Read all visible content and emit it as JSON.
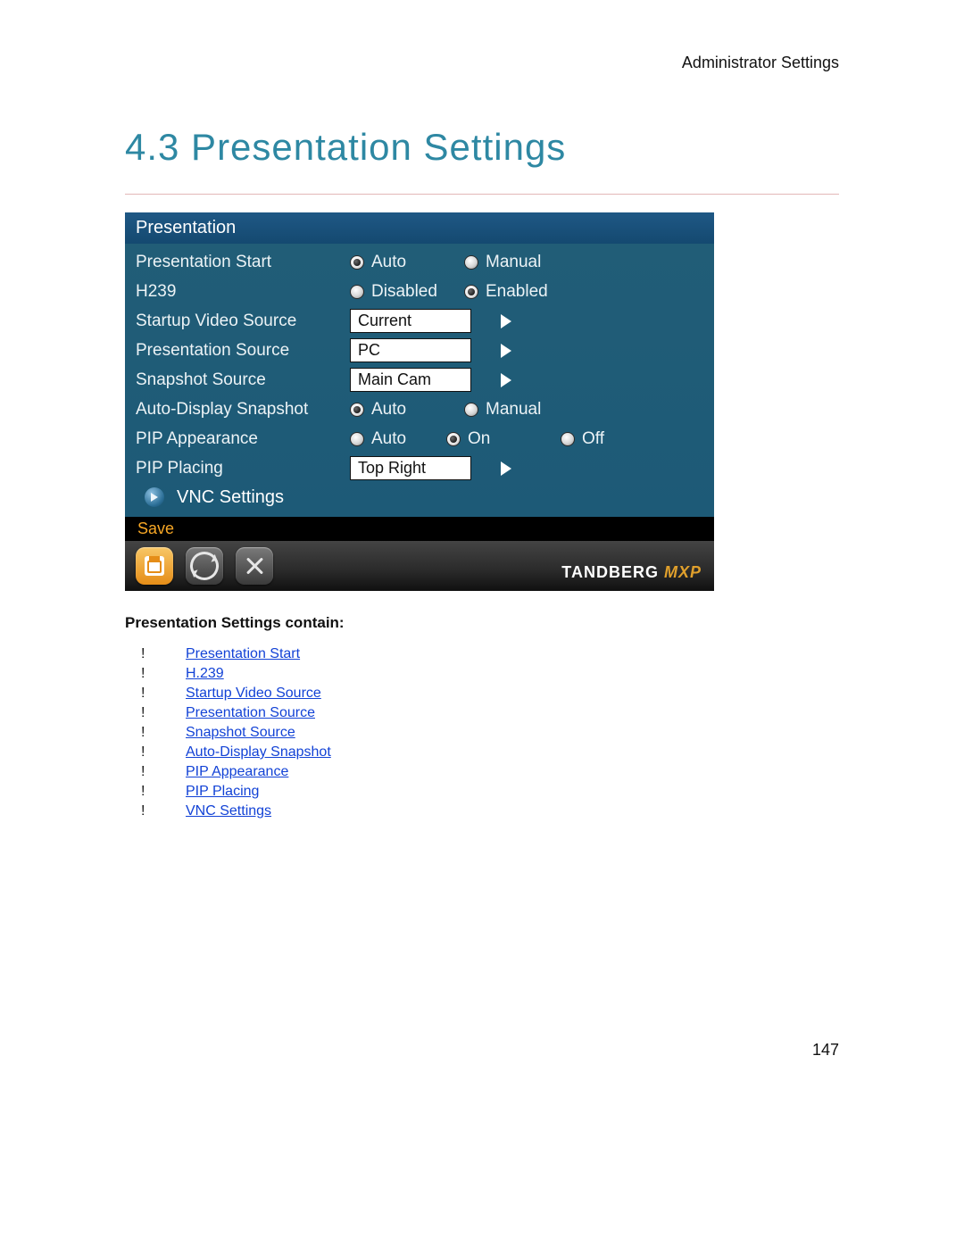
{
  "header": {
    "breadcrumb": "Administrator Settings"
  },
  "heading": "4.3 Presentation Settings",
  "panel": {
    "title": "Presentation",
    "rows": {
      "presentation_start": {
        "label": "Presentation Start",
        "opt1": "Auto",
        "opt2": "Manual"
      },
      "h239": {
        "label": "H239",
        "opt1": "Disabled",
        "opt2": "Enabled"
      },
      "startup_video_source": {
        "label": "Startup Video Source",
        "value": "Current"
      },
      "presentation_source": {
        "label": "Presentation Source",
        "value": "PC"
      },
      "snapshot_source": {
        "label": "Snapshot Source",
        "value": "Main Cam"
      },
      "auto_display_snapshot": {
        "label": "Auto-Display Snapshot",
        "opt1": "Auto",
        "opt2": "Manual"
      },
      "pip_appearance": {
        "label": "PIP Appearance",
        "opt1": "Auto",
        "opt2": "On",
        "opt3": "Off"
      },
      "pip_placing": {
        "label": "PIP Placing",
        "value": "Top Right"
      }
    },
    "vnc": "VNC Settings",
    "save_label": "Save",
    "brand": "TANDBERG",
    "brand_suffix": "MXP"
  },
  "content": {
    "intro": "Presentation Settings contain:",
    "items": [
      "Presentation Start",
      "H.239",
      "Startup Video Source",
      "Presentation Source",
      "Snapshot Source",
      "Auto-Display Snapshot",
      "PIP Appearance",
      "PIP Placing",
      "VNC Settings"
    ]
  },
  "page_number": "147"
}
